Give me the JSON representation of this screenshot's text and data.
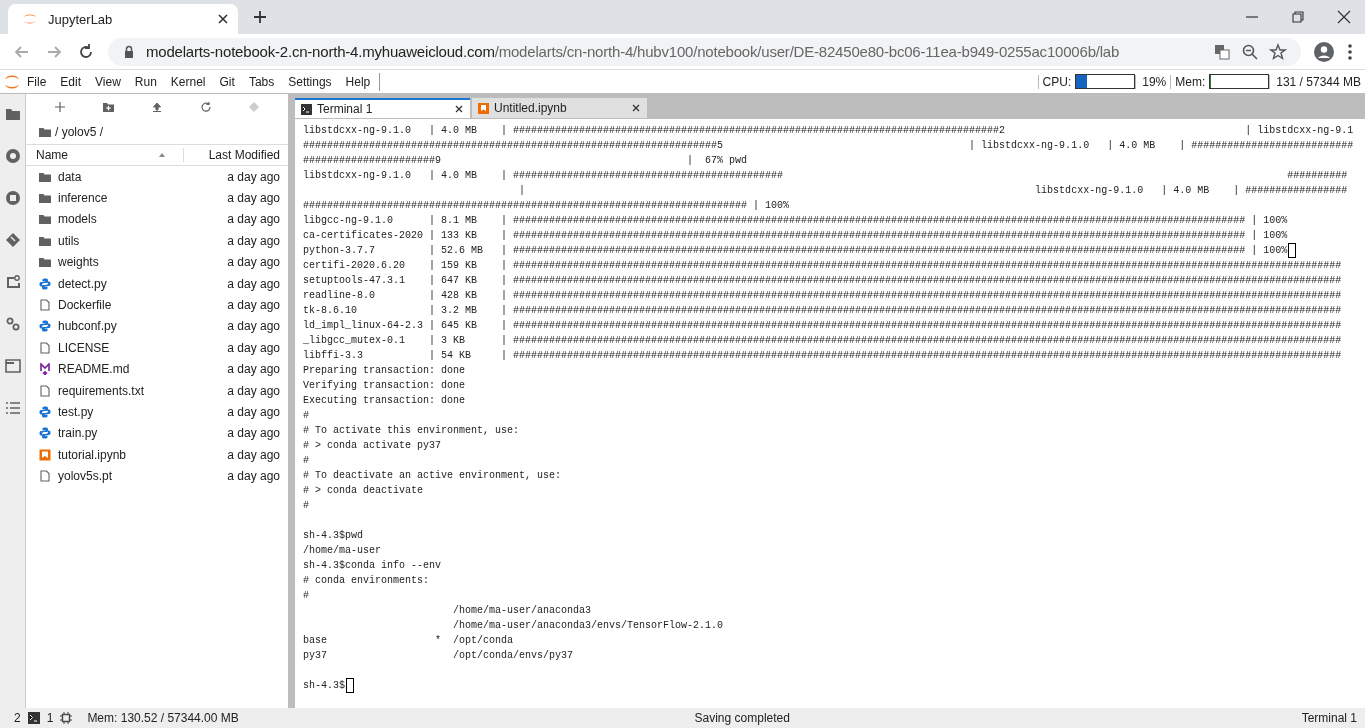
{
  "browser": {
    "tabs": [
      {
        "title": "JupyterLab",
        "selected": true
      }
    ],
    "url_host": "modelarts-notebook-2.cn-north-4.myhuaweicloud.com",
    "url_path": "/modelarts/cn-north-4/hubv100/notebook/user/DE-82450e80-bc06-11ea-b949-0255ac10006b/lab"
  },
  "menu": [
    "File",
    "Edit",
    "View",
    "Run",
    "Kernel",
    "Git",
    "Tabs",
    "Settings",
    "Help"
  ],
  "resources": {
    "cpu_label": "CPU:",
    "cpu": {
      "level": 0.19
    },
    "cpu_reading": "19%",
    "mem_label": "Mem:",
    "mem": {
      "level": 0.003
    },
    "mem_reading": "131 / 57344 MB"
  },
  "file_browser": {
    "path": "/ yolov5 /",
    "columns": [
      "Name",
      "Last Modified"
    ],
    "files": [
      {
        "name": "data",
        "kind": "folder",
        "modified": "a day ago"
      },
      {
        "name": "inference",
        "kind": "folder",
        "modified": "a day ago"
      },
      {
        "name": "models",
        "kind": "folder",
        "modified": "a day ago"
      },
      {
        "name": "utils",
        "kind": "folder",
        "modified": "a day ago"
      },
      {
        "name": "weights",
        "kind": "folder",
        "modified": "a day ago"
      },
      {
        "name": "detect.py",
        "kind": "python",
        "modified": "a day ago"
      },
      {
        "name": "Dockerfile",
        "kind": "file",
        "modified": "a day ago"
      },
      {
        "name": "hubconf.py",
        "kind": "python",
        "modified": "a day ago"
      },
      {
        "name": "LICENSE",
        "kind": "file",
        "modified": "a day ago"
      },
      {
        "name": "README.md",
        "kind": "markdown",
        "modified": "a day ago"
      },
      {
        "name": "requirements.txt",
        "kind": "file",
        "modified": "a day ago"
      },
      {
        "name": "test.py",
        "kind": "python",
        "modified": "a day ago"
      },
      {
        "name": "train.py",
        "kind": "python",
        "modified": "a day ago"
      },
      {
        "name": "tutorial.ipynb",
        "kind": "notebook",
        "modified": "a day ago"
      },
      {
        "name": "yolov5s.pt",
        "kind": "file",
        "modified": "a day ago"
      }
    ]
  },
  "doc_tabs": [
    {
      "title": "Terminal 1",
      "kind": "terminal",
      "selected": true
    },
    {
      "title": "Untitled.ipynb",
      "kind": "notebook",
      "selected": false
    }
  ],
  "terminal_blocks": [
    {
      "lines": [
        {
          "text": "libstdcxx-ng-9.1.0   | 4.0 MB    | #################################################################################2                                        | libstdcxx-ng-9.1",
          "cursor": false
        },
        {
          "text": "#####################################################################5                                         | libstdcxx-ng-9.1.0   | 4.0 MB    | ###########################",
          "cursor": false
        },
        {
          "text": "######################9                                         |  67% pwd",
          "cursor": false
        },
        {
          "text": "libstdcxx-ng-9.1.0   | 4.0 MB    | #############################################                                                                                    ##########",
          "cursor": false
        },
        {
          "text": "                                    |                                                                                     libstdcxx-ng-9.1.0   | 4.0 MB    | #################",
          "cursor": false
        },
        {
          "text": "########################################################################## | 100%",
          "cursor": false
        },
        {
          "text": "libgcc-ng-9.1.0      | 8.1 MB    | ########################################################################################################################## | 100%",
          "cursor": false
        },
        {
          "text": "ca-certificates-2020 | 133 KB    | ########################################################################################################################## | 100%",
          "cursor": false
        },
        {
          "text": "python-3.7.7         | 52.6 MB   | ########################################################################################################################## | 100%",
          "cursor": true
        },
        {
          "text": "certifi-2020.6.20    | 159 KB    | ##########################################################################################################################################",
          "cursor": false
        },
        {
          "text": "setuptools-47.3.1    | 647 KB    | ##########################################################################################################################################",
          "cursor": false
        },
        {
          "text": "readline-8.0         | 428 KB    | ##########################################################################################################################################",
          "cursor": false
        },
        {
          "text": "tk-8.6.10            | 3.2 MB    | ##########################################################################################################################################",
          "cursor": false
        },
        {
          "text": "ld_impl_linux-64-2.3 | 645 KB    | ##########################################################################################################################################",
          "cursor": false
        },
        {
          "text": "_libgcc_mutex-0.1    | 3 KB      | ##########################################################################################################################################",
          "cursor": false
        },
        {
          "text": "libffi-3.3           | 54 KB     | ##########################################################################################################################################",
          "cursor": false
        },
        {
          "text": "Preparing transaction: done",
          "cursor": false
        },
        {
          "text": "Verifying transaction: done",
          "cursor": false
        },
        {
          "text": "Executing transaction: done",
          "cursor": false
        },
        {
          "text": "#",
          "cursor": false
        },
        {
          "text": "# To activate this environment, use:",
          "cursor": false
        },
        {
          "text": "# > conda activate py37",
          "cursor": false
        },
        {
          "text": "#",
          "cursor": false
        },
        {
          "text": "# To deactivate an active environment, use:",
          "cursor": false
        },
        {
          "text": "# > conda deactivate",
          "cursor": false
        },
        {
          "text": "#",
          "cursor": false
        }
      ]
    },
    {
      "lines": [
        {
          "text": "sh-4.3$pwd",
          "cursor": false
        },
        {
          "text": "/home/ma-user",
          "cursor": false
        },
        {
          "text": "sh-4.3$conda info --env",
          "cursor": false
        },
        {
          "text": "# conda environments:",
          "cursor": false
        },
        {
          "text": "#",
          "cursor": false
        },
        {
          "text": "                         /home/ma-user/anaconda3",
          "cursor": false
        },
        {
          "text": "                         /home/ma-user/anaconda3/envs/TensorFlow-2.1.0",
          "cursor": false
        },
        {
          "text": "base                  *  /opt/conda",
          "cursor": false
        },
        {
          "text": "py37                     /opt/conda/envs/py37",
          "cursor": false
        }
      ]
    },
    {
      "lines": [
        {
          "text": "sh-4.3$",
          "cursor": true
        }
      ]
    }
  ],
  "status_bar": {
    "terminals": "2",
    "kernels": "1",
    "memory": "Mem: 130.52 / 57344.00 MB",
    "message": "Saving completed",
    "current": "Terminal 1"
  }
}
